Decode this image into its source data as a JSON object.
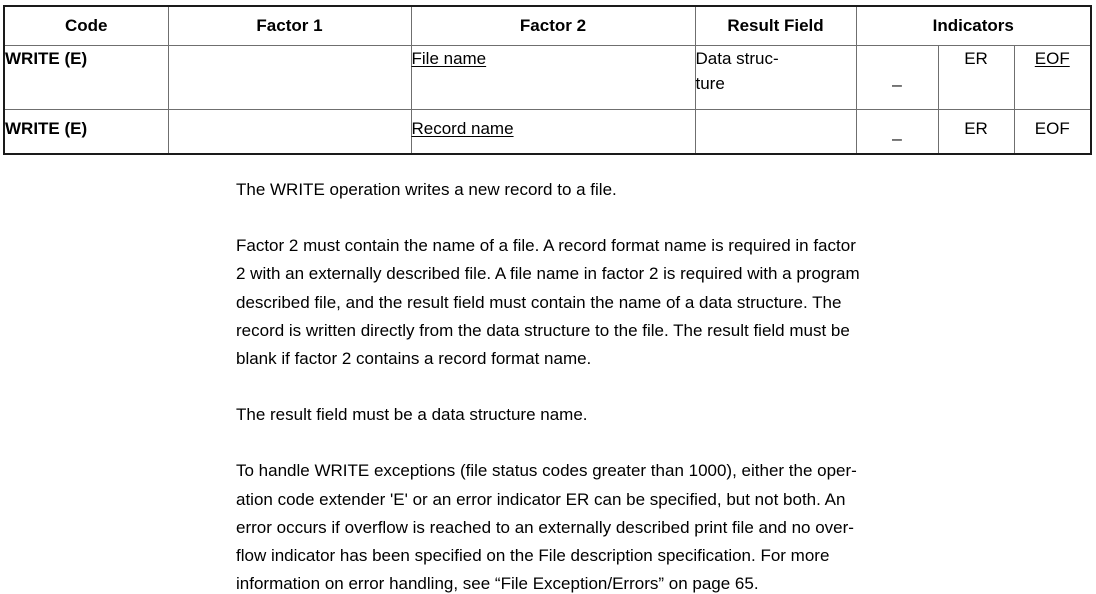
{
  "table": {
    "headers": [
      {
        "label": "Code",
        "colspan": 1
      },
      {
        "label": "Factor 1",
        "colspan": 1
      },
      {
        "label": "Factor 2",
        "colspan": 1
      },
      {
        "label": "Result Field",
        "colspan": 1
      },
      {
        "label": "Indicators",
        "colspan": 3
      }
    ],
    "rows": [
      {
        "code": "WRITE (E)",
        "factor1": "",
        "factor2": "File name",
        "factor2_underlined": true,
        "result_field": "Data struc-­ture",
        "result_field_line1": "Data struc-",
        "result_field_line2": "ture",
        "indicator1": "_",
        "indicator2": "ER",
        "indicator3": "EOF",
        "indicator3_underlined": true
      },
      {
        "code": "WRITE (E)",
        "factor1": "",
        "factor2": "Record name",
        "factor2_underlined": true,
        "result_field": "",
        "result_field_line1": "",
        "result_field_line2": "",
        "indicator1": "_",
        "indicator2": "ER",
        "indicator3": "EOF",
        "indicator3_underlined": false
      }
    ]
  },
  "body": {
    "paragraphs": [
      {
        "id": "p-intro",
        "lines": [
          "The WRITE operation writes a new record to a file."
        ]
      },
      {
        "id": "p-factor2",
        "lines": [
          "Factor 2 must contain the name of a file. A record format name is required in factor",
          "2 with an externally described file. A file name in factor 2 is required with a program",
          "described file, and the result field must contain the name of a data structure. The",
          "record is written directly from the data structure to the file. The result field must be",
          "blank if factor 2 contains a record format name."
        ]
      },
      {
        "id": "p-result-field",
        "lines": [
          "The result field must be a data structure name."
        ]
      },
      {
        "id": "p-exceptions",
        "lines": [
          "To handle WRITE exceptions (file status codes greater than 1000), either the oper-",
          "ation code extender 'E' or an error indicator ER can be specified, but not both. An",
          "error occurs if overflow is reached to an externally described print file and no over-",
          "flow indicator has been specified on the File description specification. For more",
          "information on error handling, see “File Exception/Errors” on page  65."
        ]
      }
    ]
  }
}
